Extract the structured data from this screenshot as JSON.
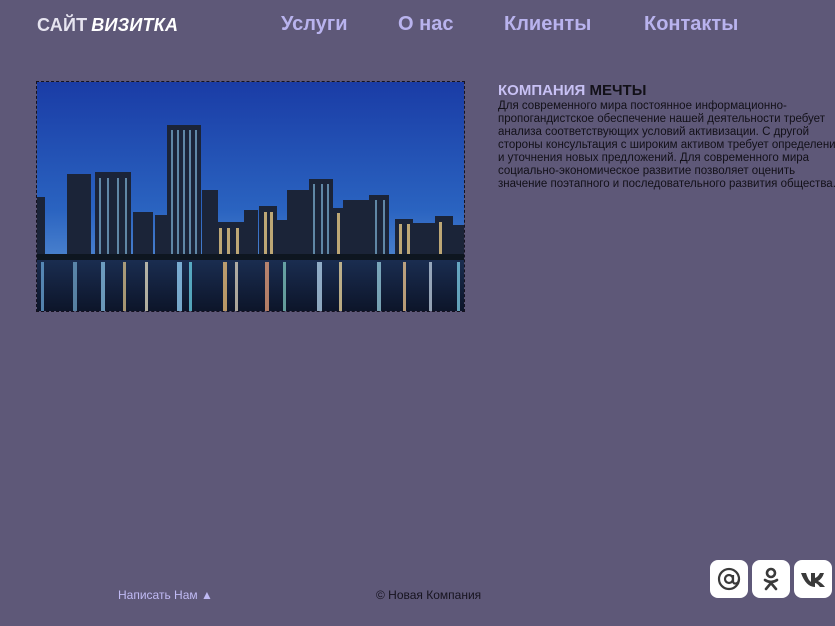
{
  "header": {
    "logo_part1": "САЙТ",
    "logo_part2": "ВИЗИТКА",
    "nav": [
      "Услуги",
      "О нас",
      "Клиенты",
      "Контакты"
    ]
  },
  "company": {
    "title_part1": "КОМПАНИЯ",
    "title_part2": "МЕЧТЫ",
    "text": "Для современного мира постоянное информационно-пропогандистское обеспечение нашей деятельности требует анализа соответствующих условий активизации. С другой стороны консультация с широким активом требует определения и уточнения новых предложений. Для современного мира социально-экономическое развитие позволяет оценить значение поэтапного и последовательного развития общества."
  },
  "footer": {
    "write_us": "Написать Нам ▲",
    "copyright": "© Новая Компания"
  },
  "socials": [
    {
      "icon": "mail-at-icon",
      "glyph": "@"
    },
    {
      "icon": "odnoklassniki-icon",
      "glyph": "ok"
    },
    {
      "icon": "vk-icon",
      "glyph": "vk"
    }
  ],
  "colors": {
    "background": "#5e5878",
    "nav_link": "#b9b3ee",
    "accent": "#c8c1f4"
  }
}
